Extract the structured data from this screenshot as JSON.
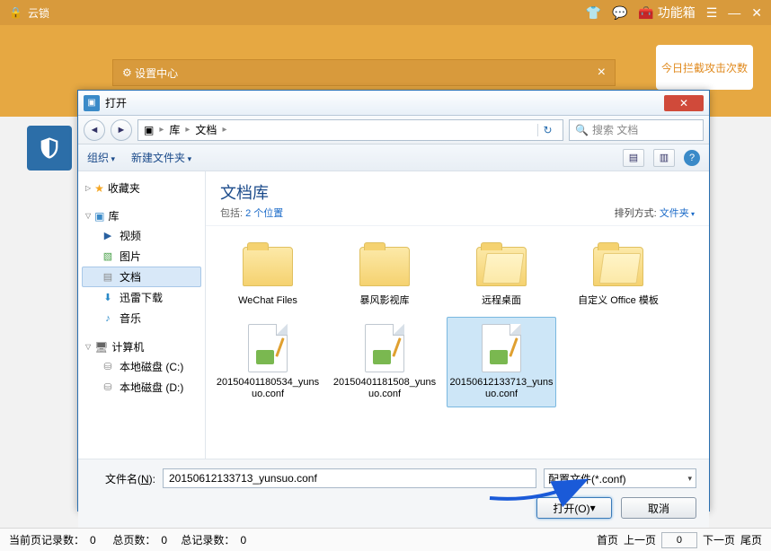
{
  "app": {
    "title": "云锁",
    "toolbox": "功能箱",
    "banner": "今日拦截攻击次数"
  },
  "settings_window": {
    "title": "设置中心"
  },
  "dialog": {
    "title": "打开",
    "breadcrumb": {
      "root": "库",
      "current": "文档"
    },
    "search_placeholder": "搜索 文档",
    "toolbar": {
      "organize": "组织",
      "new_folder": "新建文件夹"
    },
    "tree": {
      "favorites": "收藏夹",
      "libraries": "库",
      "lib_items": {
        "video": "视频",
        "pictures": "图片",
        "documents": "文档",
        "xunlei": "迅雷下载",
        "music": "音乐"
      },
      "computer": "计算机",
      "drives": {
        "c": "本地磁盘 (C:)",
        "d": "本地磁盘 (D:)"
      }
    },
    "content": {
      "lib_title": "文档库",
      "includes_prefix": "包括: ",
      "includes_link": "2 个位置",
      "arrange_label": "排列方式: ",
      "arrange_value": "文件夹",
      "items": [
        {
          "name": "WeChat Files",
          "type": "folder"
        },
        {
          "name": "暴风影视库",
          "type": "folder"
        },
        {
          "name": "远程桌面",
          "type": "folder_open"
        },
        {
          "name": "自定义 Office 模板",
          "type": "folder_open"
        },
        {
          "name": "20150401180534_yunsuo.conf",
          "type": "file"
        },
        {
          "name": "20150401181508_yunsuo.conf",
          "type": "file"
        },
        {
          "name": "20150612133713_yunsuo.conf",
          "type": "file",
          "selected": true
        }
      ]
    },
    "footer": {
      "filename_label": "文件名(N):",
      "filename_value": "20150612133713_yunsuo.conf",
      "filetype": "配置文件(*.conf)",
      "open": "打开(O)",
      "cancel": "取消"
    }
  },
  "status": {
    "current_prefix": "当前页记录数：",
    "current": "0",
    "pages_prefix": "总页数：",
    "pages": "0",
    "total_prefix": "总记录数：",
    "total": "0",
    "first": "首页",
    "prev": "上一页",
    "page": "0",
    "next": "下一页",
    "last": "尾页"
  }
}
